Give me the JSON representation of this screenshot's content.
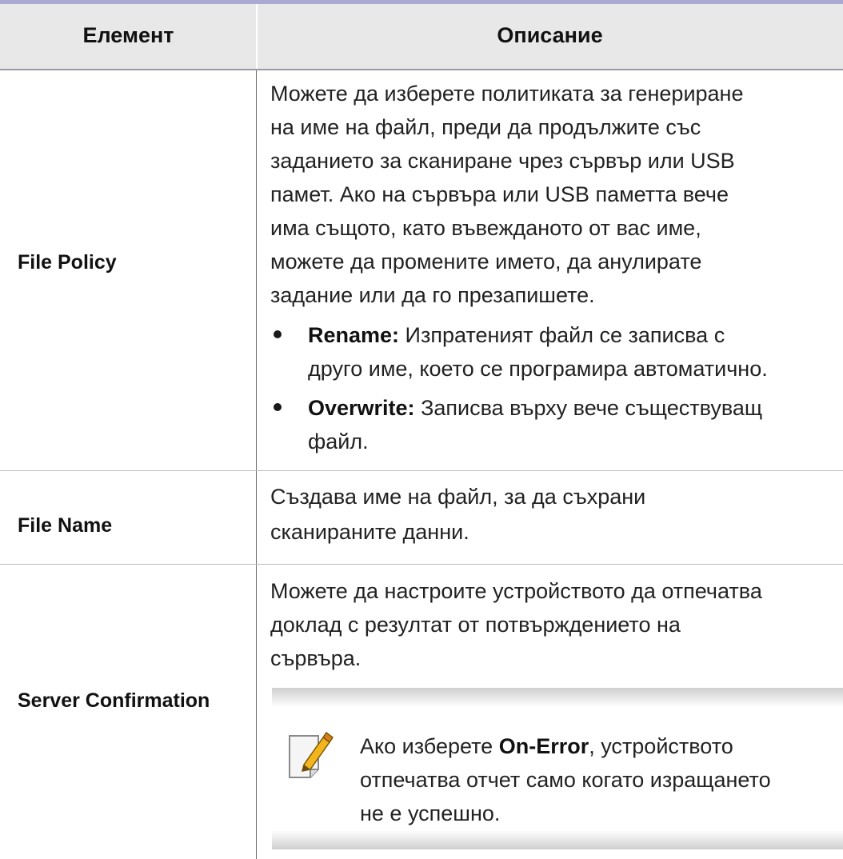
{
  "table": {
    "header": {
      "col1": "Елемент",
      "col2": "Описание"
    },
    "file_policy": {
      "element": "File Policy",
      "lines": [
        "Можете да изберете политиката за генериране",
        "на име на файл, преди да продължите със",
        "заданието за сканиране чрез сървър или USB",
        "памет. Ако на сървъра или USB паметта вече",
        "има същото, като въвежданото от вас име,",
        "можете да промените името, да анулирате",
        "задание или да го презапишете."
      ],
      "bullets": [
        {
          "term": "Rename:",
          "text1": " Изпратеният файл се записва с",
          "text2": "друго име, което се програмира автоматично."
        },
        {
          "term": "Overwrite:",
          "text1": " Записва върху вече съществуващ",
          "text2": "файл."
        }
      ]
    },
    "file_name": {
      "element": "File Name",
      "lines": [
        "Създава име на файл, за да съхрани",
        "сканираните данни."
      ]
    },
    "server_confirmation": {
      "element": "Server Confirmation",
      "lines": [
        "Можете да настроите устройството да отпечатва",
        "доклад с резултат от потвърждението на",
        "сървъра."
      ],
      "note": {
        "icon": "note-pencil-icon",
        "pre": "Ако изберете ",
        "bold": "On-Error",
        "post": ", устройството",
        "line2": "отпечатва отчет само когато изращането",
        "line3": "не е успешно."
      }
    }
  }
}
